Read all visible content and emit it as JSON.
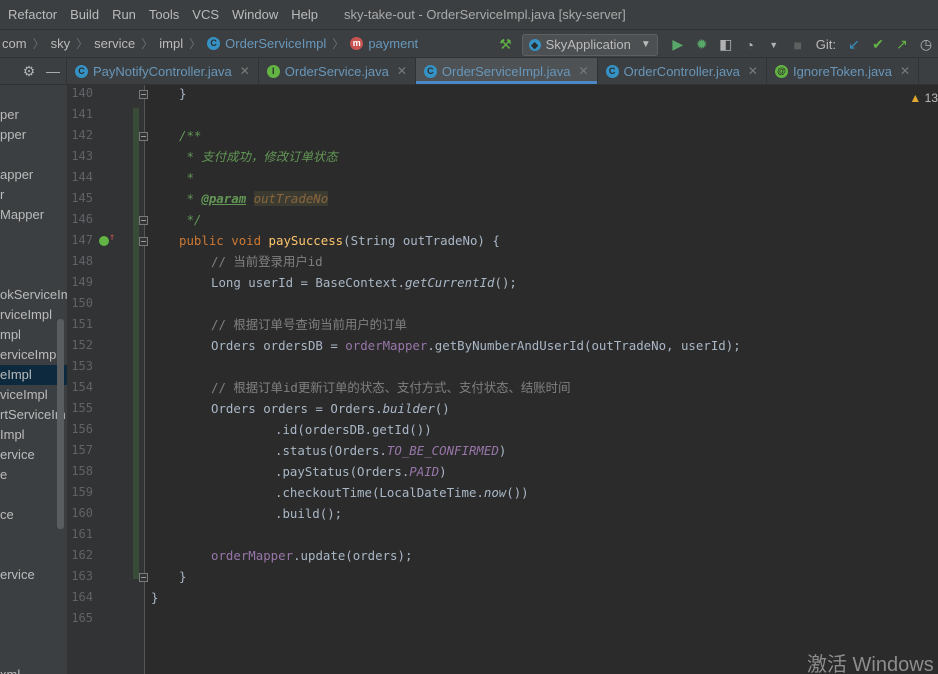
{
  "menubar": {
    "items": [
      "Refactor",
      "Build",
      "Run",
      "Tools",
      "VCS",
      "Window",
      "Help"
    ],
    "window_title": "sky-take-out - OrderServiceImpl.java [sky-server]"
  },
  "breadcrumb": {
    "items": [
      "com",
      "sky",
      "service",
      "impl",
      "OrderServiceImpl",
      "payment"
    ]
  },
  "toolbar": {
    "run_config": "SkyApplication",
    "git_label": "Git:"
  },
  "tabs": [
    {
      "label": "PayNotifyController.java",
      "icon": "class-icon",
      "active": false
    },
    {
      "label": "OrderService.java",
      "icon": "interface-icon",
      "active": false
    },
    {
      "label": "OrderServiceImpl.java",
      "icon": "class-icon",
      "active": true
    },
    {
      "label": "OrderController.java",
      "icon": "class-icon",
      "active": false
    },
    {
      "label": "IgnoreToken.java",
      "icon": "annotation-icon",
      "active": false
    }
  ],
  "project_tree": {
    "items": [
      "per",
      "pper",
      "",
      "apper",
      "r",
      "Mapper",
      "",
      "",
      "okServiceIm",
      "rviceImpl",
      "mpl",
      "erviceImpl",
      "eImpl",
      "viceImpl",
      "rtServiceIm",
      "Impl",
      "ervice",
      "e",
      "",
      "ce",
      "",
      "",
      "ervice",
      "",
      "",
      "xml"
    ],
    "selected_index": 12
  },
  "editor": {
    "warning_count": "13",
    "line_numbers": [
      "140",
      "141",
      "142",
      "143",
      "144",
      "145",
      "146",
      "147",
      "148",
      "149",
      "150",
      "151",
      "152",
      "153",
      "154",
      "155",
      "156",
      "157",
      "158",
      "159",
      "160",
      "161",
      "162",
      "163",
      "164",
      "165"
    ],
    "code": {
      "l140": "}",
      "l142": "/**",
      "l143": " * 支付成功，修改订单状态",
      "l144": " *",
      "l145_pre": " * ",
      "l145_tag": "@param",
      "l145_sp": " ",
      "l145_param": "outTradeNo",
      "l146": " */",
      "l147_kw1": "public",
      "l147_kw2": "void",
      "l147_fn": "paySuccess",
      "l147_rest": "(String outTradeNo) {",
      "l148": "// 当前登录用户id",
      "l149_a": "Long userId = BaseContext.",
      "l149_b": "getCurrentId",
      "l149_c": "();",
      "l151": "// 根据订单号查询当前用户的订单",
      "l152_a": "Orders ordersDB = ",
      "l152_b": "orderMapper",
      "l152_c": ".getByNumberAndUserId(outTradeNo, userId);",
      "l154": "// 根据订单id更新订单的状态、支付方式、支付状态、结账时间",
      "l155_a": "Orders orders = Orders.",
      "l155_b": "builder",
      "l155_c": "()",
      "l156": ".id(ordersDB.getId())",
      "l157_a": ".status(Orders.",
      "l157_b": "TO_BE_CONFIRMED",
      "l157_c": ")",
      "l158_a": ".payStatus(Orders.",
      "l158_b": "PAID",
      "l158_c": ")",
      "l159_a": ".checkoutTime(LocalDateTime.",
      "l159_b": "now",
      "l159_c": "())",
      "l160": ".build();",
      "l162_a": "orderMapper",
      "l162_b": ".update(orders);",
      "l163": "}",
      "l164": "}"
    }
  },
  "watermark": "激活 Windows",
  "colors": {
    "keyword": "#cc7832",
    "comment": "#808080",
    "doc": "#629755",
    "function": "#ffc66d",
    "field": "#9876aa",
    "accent_tab": "#4a88c7"
  }
}
